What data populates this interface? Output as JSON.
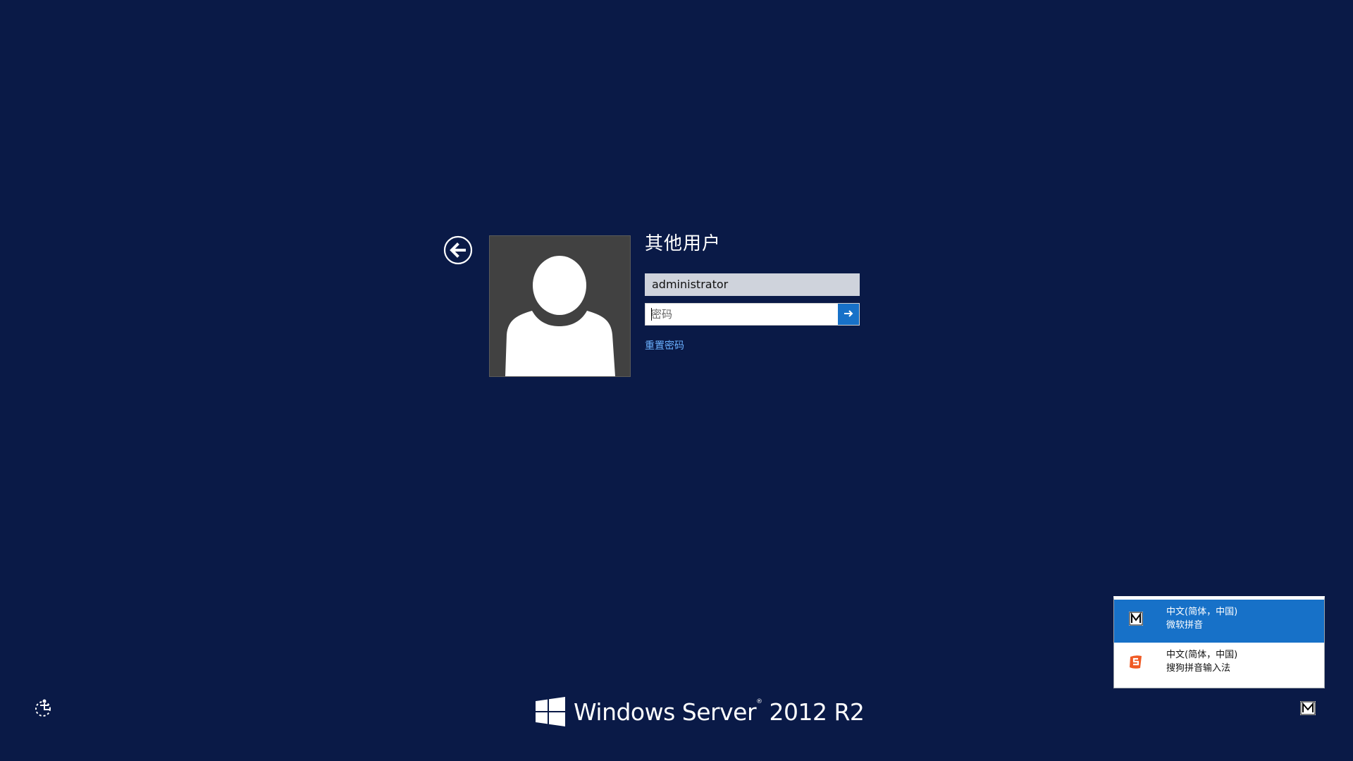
{
  "login": {
    "user_display_name": "其他用户",
    "username_value": "administrator",
    "password_placeholder": "密码",
    "reset_password_link": "重置密码"
  },
  "branding": {
    "product_name": "Windows Server",
    "trademark": "®",
    "version": "2012 R2"
  },
  "ime_menu": {
    "items": [
      {
        "line1": "中文(简体，中国)",
        "line2": "微软拼音",
        "icon": "microsoft-pinyin-icon",
        "selected": true
      },
      {
        "line1": "中文(简体，中国)",
        "line2": "搜狗拼音输入法",
        "icon": "sogou-pinyin-icon",
        "selected": false
      }
    ]
  },
  "colors": {
    "background": "#0a1a47",
    "accent": "#1771c8",
    "link": "#6bb1ff",
    "sogou_orange": "#f05a24"
  },
  "icons": {
    "back": "back-arrow-icon",
    "submit": "arrow-right-icon",
    "ease_of_access": "ease-of-access-icon",
    "input_indicator": "microsoft-pinyin-icon",
    "windows_logo": "windows-logo-icon"
  }
}
